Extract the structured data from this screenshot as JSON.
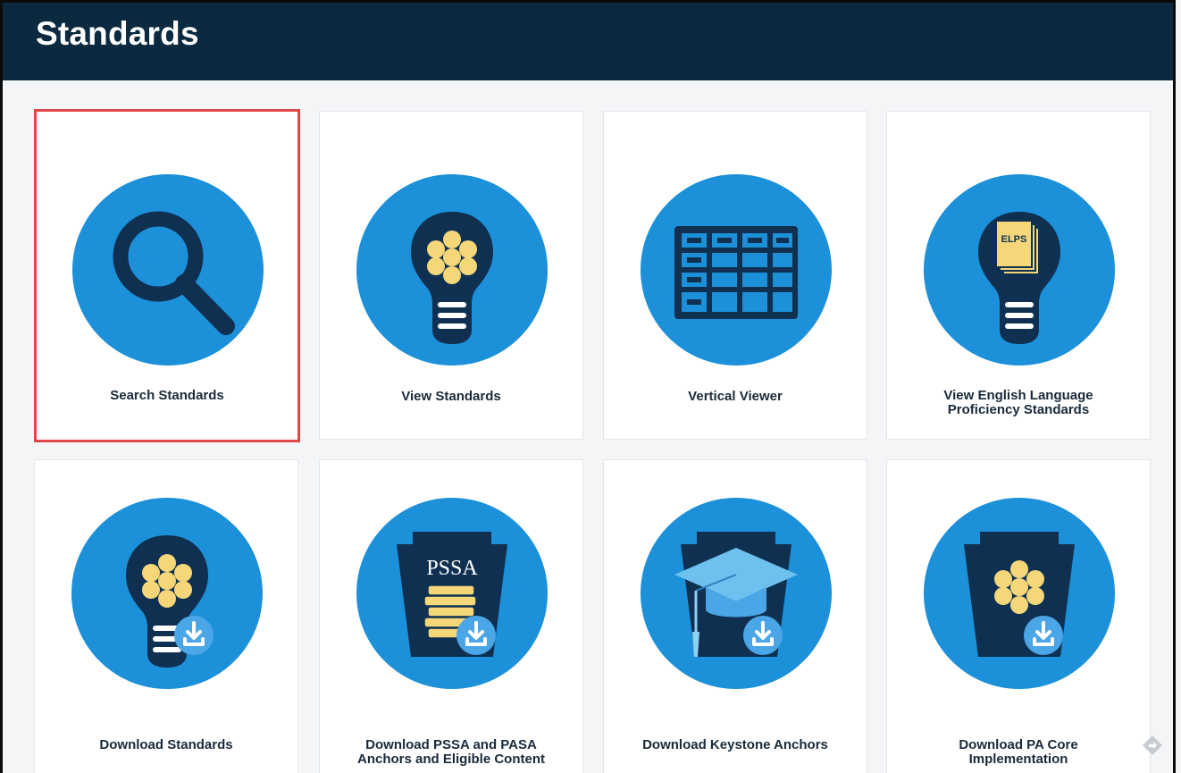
{
  "header": {
    "title": "Standards"
  },
  "cards": [
    {
      "label": "Search Standards",
      "icon": "magnifier-icon",
      "selected": true
    },
    {
      "label": "View Standards",
      "icon": "lightbulb-icon",
      "selected": false
    },
    {
      "label": "Vertical Viewer",
      "icon": "grid-table-icon",
      "selected": false
    },
    {
      "label_line1": "View English Language",
      "label_line2": "Proficiency Standards",
      "icon": "elps-lightbulb-icon",
      "icon_text": "ELPS",
      "selected": false
    },
    {
      "label": "Download Standards",
      "icon": "lightbulb-download-icon",
      "selected": false
    },
    {
      "label_line1": "Download PSSA and PASA",
      "label_line2": "Anchors and Eligible Content",
      "icon": "pssa-keystone-download-icon",
      "icon_text": "PSSA",
      "selected": false
    },
    {
      "label": "Download Keystone Anchors",
      "icon": "graduation-cap-download-icon",
      "selected": false
    },
    {
      "label_line1": "Download PA Core",
      "label_line2": "Implementation",
      "icon": "keystone-flower-download-icon",
      "selected": false
    }
  ],
  "colors": {
    "header_bg": "#0b2a40",
    "circle": "#1c90d9",
    "dark": "#0f3050",
    "accent_yellow": "#f5d77a",
    "selected_border": "#e04848"
  }
}
